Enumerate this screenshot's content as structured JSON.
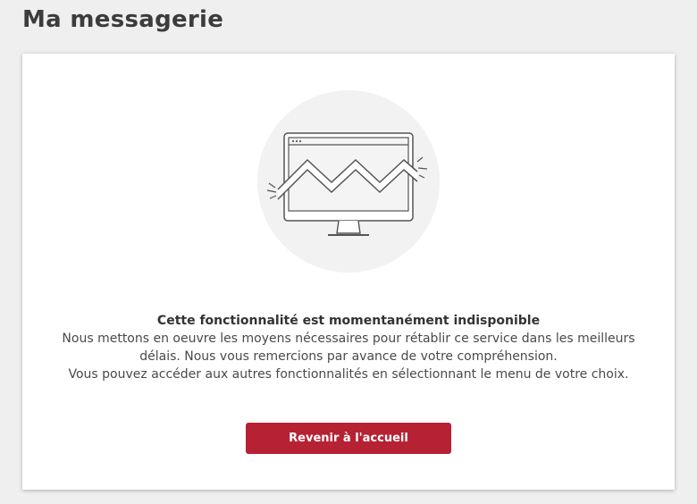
{
  "header": {
    "title": "Ma messagerie"
  },
  "illustration": {
    "icon": "broken-monitor-icon",
    "circle_color": "#f2f2f2",
    "stroke_color": "#555555"
  },
  "message": {
    "title": "Cette fonctionnalité est momentanément indisponible",
    "line1": "Nous mettons en oeuvre les moyens nécessaires pour rétablir ce service dans les meilleurs",
    "line2": "délais. Nous vous remercions par avance de votre compréhension.",
    "line3": "Vous pouvez accéder aux autres fonctionnalités en sélectionnant le menu de votre choix."
  },
  "actions": {
    "home_button_label": "Revenir à l'accueil",
    "home_button_color": "#b72134"
  }
}
